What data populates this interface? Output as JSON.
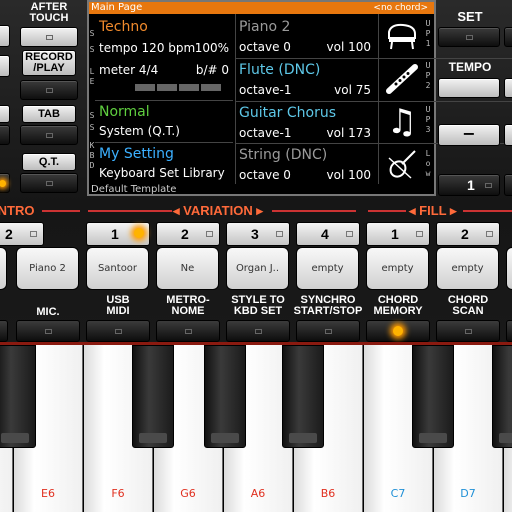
{
  "left_panel": {
    "after_touch": "AFTER\nTOUCH",
    "record_play": "RECORD\n/PLAY",
    "tab": "TAB",
    "qt": "Q.T."
  },
  "right_panel": {
    "set": "SET",
    "tempo": "TEMPO",
    "minus": "−",
    "tempo_value": "1"
  },
  "screen": {
    "title": "Main Page",
    "chord": "<no chord>",
    "template": "Default Template",
    "style": {
      "name": "Techno",
      "tempo": "tempo 120 bpm",
      "volume": "100%",
      "meter": "meter 4/4",
      "key": "b/# 0"
    },
    "normal": {
      "name": "Normal",
      "sub": "System (Q.T.)"
    },
    "my_setting": {
      "name": "My Setting",
      "sub": "Keyboard Set Library"
    },
    "parts": [
      {
        "name": "Piano 2",
        "octave": "octave 0",
        "vol": "vol 100",
        "icon": "piano-icon"
      },
      {
        "name": "Flute (DNC)",
        "octave": "octave-1",
        "vol": "vol 75",
        "icon": "flute-icon"
      },
      {
        "name": "Guitar Chorus",
        "octave": "octave-1",
        "vol": "vol 173",
        "icon": "music-note-icon"
      },
      {
        "name": "String (DNC)",
        "octave": "octave 0",
        "vol": "vol 100",
        "icon": "violin-icon"
      }
    ],
    "side_left": [
      "S",
      "S",
      "L",
      "E",
      "S",
      "S",
      "K",
      "B",
      "D"
    ],
    "side_right": [
      "U",
      "P",
      "1",
      "U",
      "P",
      "2",
      "U",
      "P",
      "3",
      "L",
      "o",
      "w"
    ]
  },
  "sections": {
    "intro": "INTRO",
    "variation": "VARIATION",
    "fill": "FILL"
  },
  "variation_buttons": [
    {
      "label": "2",
      "led": false
    },
    {
      "label": "1",
      "led": true
    },
    {
      "label": "2",
      "led": false
    },
    {
      "label": "3",
      "led": false
    },
    {
      "label": "4",
      "led": false
    },
    {
      "label": "1",
      "led": false
    },
    {
      "label": "2",
      "led": false
    }
  ],
  "pads": [
    "Piano 2",
    "Santoor",
    "Ne",
    "Organ J..",
    "empty",
    "empty",
    "empty"
  ],
  "functions": [
    {
      "label": "MIC.",
      "led": false
    },
    {
      "label": "USB\nMIDI",
      "led": false
    },
    {
      "label": "METRO-\nNOME",
      "led": false
    },
    {
      "label": "STYLE TO\nKBD SET",
      "led": false
    },
    {
      "label": "SYNCHRO\nSTART/STOP",
      "led": false
    },
    {
      "label": "CHORD\nMEMORY",
      "led": true
    },
    {
      "label": "CHORD\nSCAN",
      "led": false
    }
  ],
  "keys": [
    {
      "note": "E6",
      "color": "#e03020"
    },
    {
      "note": "F6",
      "color": "#e03020"
    },
    {
      "note": "G6",
      "color": "#e03020"
    },
    {
      "note": "A6",
      "color": "#e03020"
    },
    {
      "note": "B6",
      "color": "#e03020"
    },
    {
      "note": "C7",
      "color": "#1e8fd6"
    },
    {
      "note": "D7",
      "color": "#1e8fd6"
    }
  ]
}
